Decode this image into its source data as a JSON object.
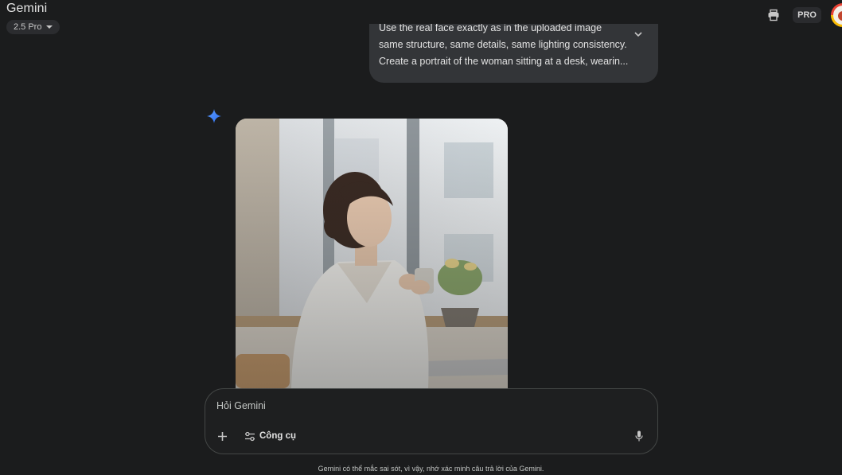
{
  "app": {
    "title": "Gemini",
    "model_label": "2.5 Pro"
  },
  "header": {
    "pro_badge": "PRO",
    "icons": [
      "print-icon",
      "account-avatar"
    ]
  },
  "conversation": {
    "user_message": {
      "lines": [
        "Use the real face exactly as in the uploaded image",
        "same structure, same details, same lighting consistency.",
        "Create a portrait of the woman sitting at a desk, wearin..."
      ]
    },
    "response": {
      "image_description_icon": "gemini-spark-icon"
    }
  },
  "composer": {
    "placeholder": "Hỏi Gemini",
    "tools_label": "Công cụ"
  },
  "footer": {
    "disclaimer": "Gemini có thể mắc sai sót, vì vậy, nhớ xác minh câu trả lời của Gemini."
  },
  "colors": {
    "background": "#1b1c1d",
    "bubble": "#333538",
    "accent_blue": "#4285f4"
  }
}
